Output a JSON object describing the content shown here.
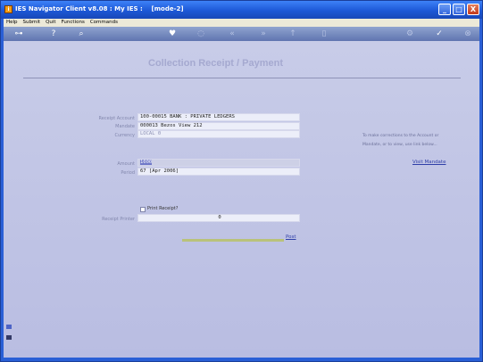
{
  "window": {
    "app_icon": "app-logo-icon",
    "title": "IES Navigator Client v8.08 : My IES :    [mode-2]",
    "buttons": {
      "minimize": "_",
      "maximize": "□",
      "close": "X"
    }
  },
  "menu": {
    "items": [
      "Help",
      "Submit",
      "Quit",
      "Functions",
      "Commands"
    ]
  },
  "toolbar": {
    "icons": [
      "key-icon",
      "help-icon",
      "search-icon",
      "heart-icon",
      "refresh-icon",
      "rewind-icon",
      "forward-icon",
      "up-icon",
      "delete-icon",
      "settings-icon",
      "check-icon",
      "close-icon"
    ],
    "glyphs": {
      "key": "⊶",
      "help": "?",
      "search": "⌕",
      "heart": "♥",
      "refresh": "◌",
      "rewind": "«",
      "forward": "»",
      "up": "↑",
      "delete": "▯",
      "settings": "⚙",
      "check": "✓",
      "close": "⊗"
    }
  },
  "form": {
    "title": "Collection Receipt / Payment",
    "labels": {
      "receipt_account": "Receipt Account",
      "mandate": "Mandate",
      "currency": "Currency",
      "amount": "Amount",
      "period": "Period",
      "receipt_printer": "Receipt Printer"
    },
    "values": {
      "receipt_account": "100-00015 BANK : PRIVATE LEDGERS",
      "mandate": "000013 Bezos View 212",
      "currency": "LOCAL 0",
      "amount": "1000",
      "period": "67  [Apr 2006]",
      "receipt_printer": "0"
    },
    "print_receipt_label": "Print Receipt?",
    "post_label": "Post"
  },
  "sidebar_hint": {
    "line1": "To make corrections to the Account or",
    "line2": "Mandate, or to view, use link below...",
    "link": "Visit Mandate"
  }
}
